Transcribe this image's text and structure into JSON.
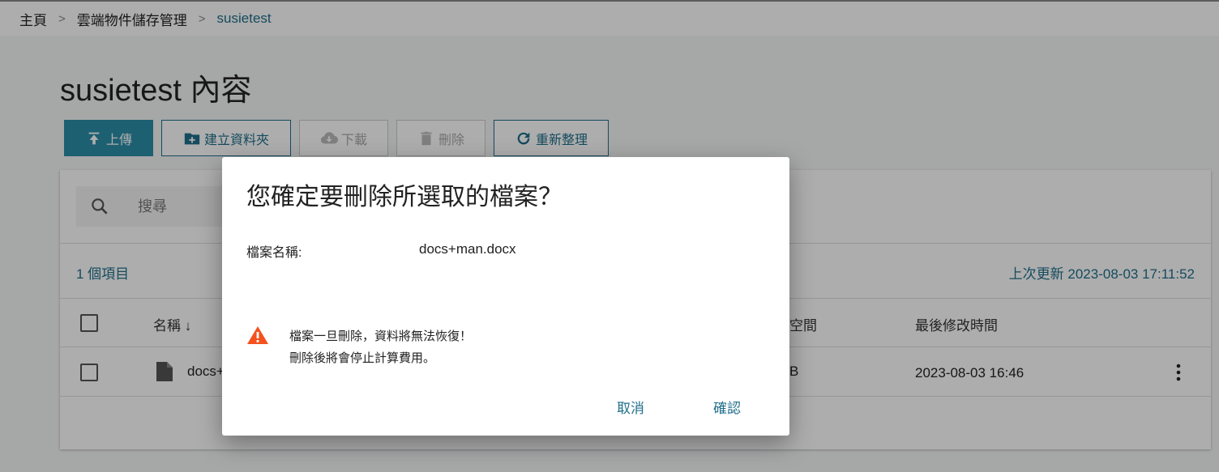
{
  "breadcrumb": {
    "home": "主頁",
    "section": "雲端物件儲存管理",
    "current": "susietest",
    "separator": ">"
  },
  "page_title": "susietest 內容",
  "toolbar": {
    "upload": "上傳",
    "new_folder": "建立資料夾",
    "download": "下載",
    "delete": "刪除",
    "refresh": "重新整理"
  },
  "search": {
    "placeholder": "搜尋"
  },
  "summary": {
    "count": "1 個項目",
    "updated": "上次更新 2023-08-03 17:11:52"
  },
  "table": {
    "columns": {
      "name": "名稱 ↓",
      "size": "空間",
      "modified": "最後修改時間"
    },
    "rows": [
      {
        "name": "docs+",
        "size": "B",
        "modified": "2023-08-03 16:46"
      }
    ]
  },
  "dialog": {
    "title": "您確定要刪除所選取的檔案？",
    "file_label": "檔案名稱:",
    "file_name": "docs+man.docx",
    "warning_line1": "檔案一旦刪除，資料將無法恢復！",
    "warning_line2": "刪除後將會停止計算費用。",
    "cancel": "取消",
    "confirm": "確認"
  },
  "colors": {
    "accent": "#1f6f8b",
    "primary_button": "#2a8ea8",
    "warning": "#f4511e"
  },
  "icons": {
    "upload": "upload-icon",
    "folder_add": "folder-plus-icon",
    "download": "cloud-download-icon",
    "delete": "trash-icon",
    "refresh": "refresh-icon",
    "search": "search-icon",
    "file": "file-icon",
    "more": "more-vertical-icon",
    "warning": "warning-triangle-icon"
  }
}
